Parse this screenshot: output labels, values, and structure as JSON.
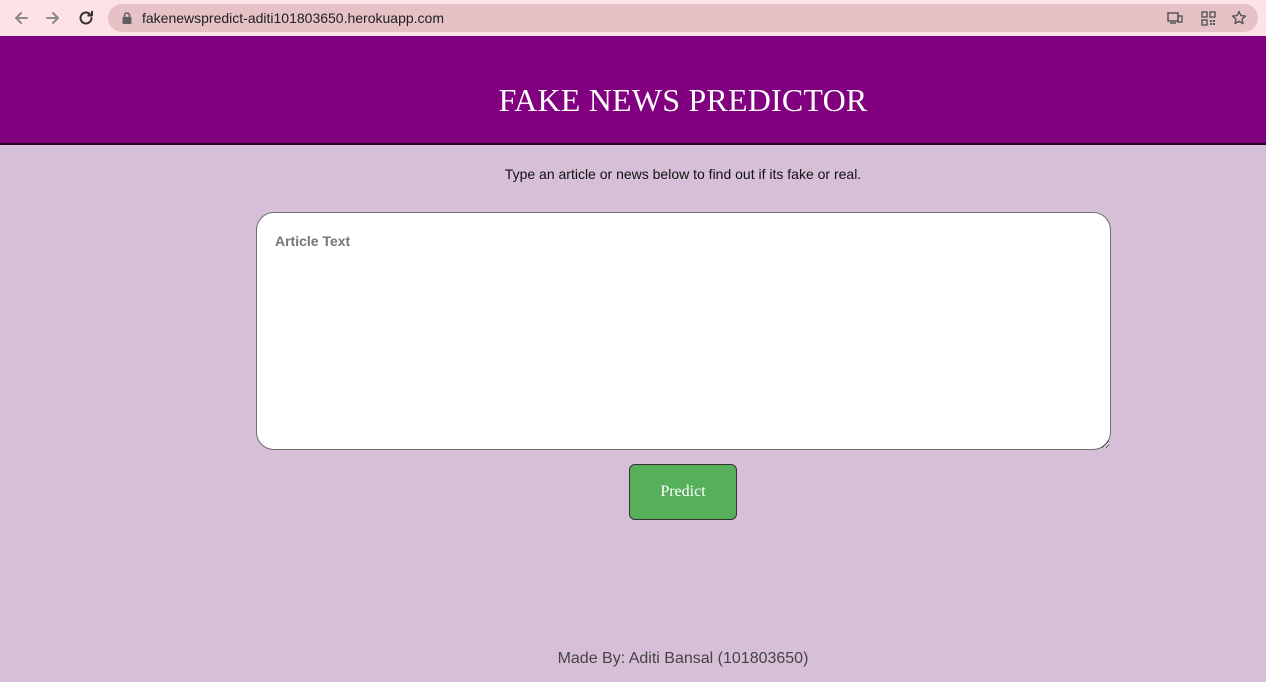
{
  "browser": {
    "url": "fakenewspredict-aditi101803650.herokuapp.com",
    "icons": [
      "back-arrow-icon",
      "forward-arrow-icon",
      "reload-icon",
      "lock-icon",
      "cast-icon",
      "qr-code-icon",
      "star-icon"
    ]
  },
  "header": {
    "title": "FAKE NEWS PREDICTOR",
    "background": "#800080"
  },
  "main": {
    "subtitle": "Type an article or news below to find out if its fake or real.",
    "article_placeholder": "Article Text",
    "article_value": "",
    "predict_label": "Predict",
    "predict_color": "#56b05a"
  },
  "footer": {
    "credit": "Made By: Aditi Bansal (101803650)"
  },
  "colors": {
    "page_background": "#d8bfd8",
    "browser_bar": "#fde2e6"
  }
}
